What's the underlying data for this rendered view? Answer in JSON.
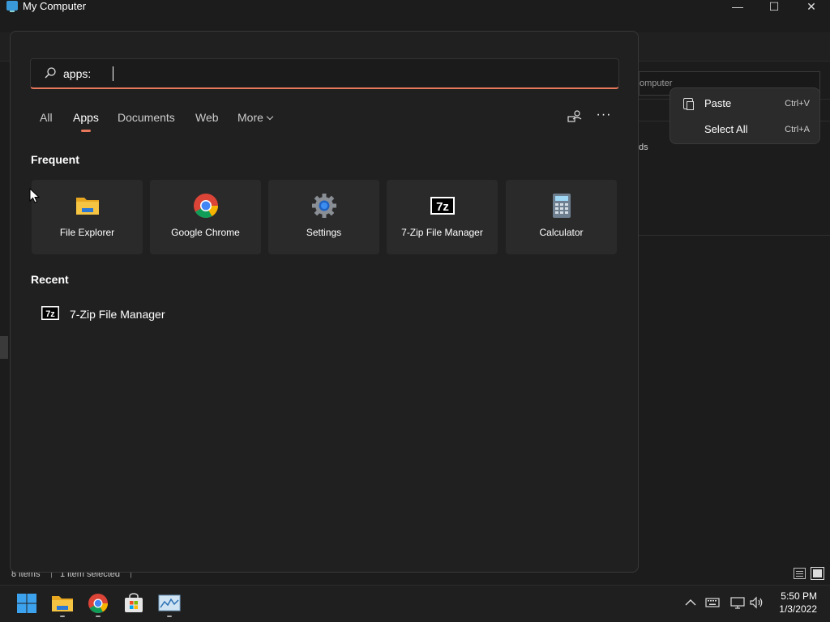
{
  "window": {
    "title": "My Computer",
    "address_text": "omputer",
    "partial_item": "ds",
    "status_items": "8 items",
    "status_selected": "1 item selected",
    "status_separator": "|"
  },
  "context_menu": {
    "items": [
      {
        "label": "Paste",
        "shortcut": "Ctrl+V",
        "icon": "clipboard-icon"
      },
      {
        "label": "Select All",
        "shortcut": "Ctrl+A"
      }
    ]
  },
  "search": {
    "query": "apps:",
    "tabs": [
      {
        "label": "All"
      },
      {
        "label": "Apps",
        "selected": true
      },
      {
        "label": "Documents"
      },
      {
        "label": "Web"
      },
      {
        "label": "More"
      }
    ],
    "more_options_label": "···",
    "frequent_heading": "Frequent",
    "frequent": [
      {
        "label": "File Explorer",
        "icon": "file-explorer-icon"
      },
      {
        "label": "Google Chrome",
        "icon": "chrome-icon"
      },
      {
        "label": "Settings",
        "icon": "settings-gear-icon"
      },
      {
        "label": "7-Zip File Manager",
        "icon": "7zip-icon"
      },
      {
        "label": "Calculator",
        "icon": "calculator-icon"
      }
    ],
    "recent_heading": "Recent",
    "recent": [
      {
        "label": "7-Zip File Manager",
        "icon": "7zip-icon"
      }
    ]
  },
  "taskbar": {
    "apps": [
      "windows-start-icon",
      "file-explorer-icon",
      "chrome-icon",
      "store-icon",
      "resource-monitor-icon"
    ],
    "tray": [
      "chevron-up-icon",
      "keyboard-icon",
      "network-icon",
      "volume-icon"
    ],
    "time": "5:50 PM",
    "date": "1/3/2022"
  },
  "colors": {
    "accent": "#e8785c",
    "panel_bg": "#202020",
    "tile_bg": "#2a2a2a"
  }
}
